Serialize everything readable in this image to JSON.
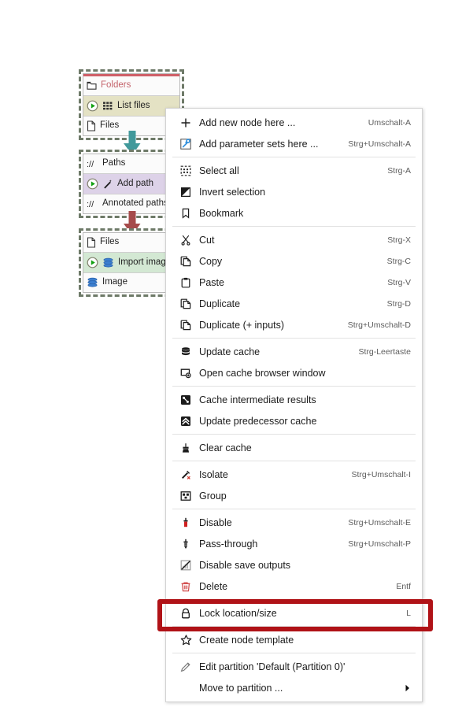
{
  "canvas": {
    "background": "#ffffff"
  },
  "workflow": {
    "nodes": [
      {
        "id": "list-files",
        "top_accent_color": "#cf5f68",
        "body_color": "#e4e2c4",
        "input_port": {
          "label": "Folders",
          "icon": "folder-icon",
          "label_color": "#c4636b"
        },
        "body": {
          "label": "List files",
          "icon": "table-grid-icon",
          "run_icon": "play-circle-icon"
        },
        "output_port": {
          "label": "Files",
          "icon": "file-icon",
          "label_color": "#333333"
        }
      },
      {
        "id": "add-path",
        "top_accent_color": "",
        "body_color": "#ddd2e8",
        "input_port": {
          "label": "Paths",
          "icon": "path-uri-icon",
          "label_color": "#333333"
        },
        "body": {
          "label": "Add path",
          "icon": "wand-icon",
          "run_icon": "play-circle-icon"
        },
        "output_port": {
          "label": "Annotated paths",
          "icon": "path-uri-icon",
          "label_color": "#333333"
        }
      },
      {
        "id": "import-image",
        "top_accent_color": "",
        "body_color": "#d3e8d3",
        "input_port": {
          "label": "Files",
          "icon": "file-icon",
          "label_color": "#333333"
        },
        "body": {
          "label": "Import image",
          "icon": "stack-layers-icon",
          "run_icon": "play-circle-icon"
        },
        "output_port": {
          "label": "Image",
          "icon": "stack-layers-icon",
          "label_color": "#333333"
        }
      }
    ],
    "connectors": [
      {
        "id": "conn-1",
        "icon": "down-arrow-icon",
        "color": "#3f9e9e"
      },
      {
        "id": "conn-2",
        "icon": "down-arrow-icon",
        "color": "#a54040"
      }
    ]
  },
  "context_menu": {
    "groups": [
      {
        "items": [
          {
            "icon": "plus-icon",
            "label": "Add new node here ...",
            "accel": "Umschalt-A"
          },
          {
            "icon": "wrench-icon",
            "label": "Add parameter sets here ...",
            "accel": "Strg+Umschalt-A"
          }
        ]
      },
      {
        "items": [
          {
            "icon": "select-all-icon",
            "label": "Select all",
            "accel": "Strg-A"
          },
          {
            "icon": "invert-selection-icon",
            "label": "Invert selection",
            "accel": ""
          },
          {
            "icon": "bookmark-icon",
            "label": "Bookmark",
            "accel": ""
          }
        ]
      },
      {
        "items": [
          {
            "icon": "scissors-icon",
            "label": "Cut",
            "accel": "Strg-X"
          },
          {
            "icon": "copy-icon",
            "label": "Copy",
            "accel": "Strg-C"
          },
          {
            "icon": "clipboard-icon",
            "label": "Paste",
            "accel": "Strg-V"
          },
          {
            "icon": "copy-icon",
            "label": "Duplicate",
            "accel": "Strg-D"
          },
          {
            "icon": "copy-icon",
            "label": "Duplicate (+ inputs)",
            "accel": "Strg+Umschalt-D"
          }
        ]
      },
      {
        "items": [
          {
            "icon": "database-icon",
            "label": "Update cache",
            "accel": "Strg-Leertaste"
          },
          {
            "icon": "window-plus-icon",
            "label": "Open cache browser window",
            "accel": ""
          }
        ]
      },
      {
        "items": [
          {
            "icon": "cache-intermediate-icon",
            "label": "Cache intermediate results",
            "accel": ""
          },
          {
            "icon": "chevrons-up-icon",
            "label": "Update predecessor cache",
            "accel": ""
          }
        ]
      },
      {
        "items": [
          {
            "icon": "broom-icon",
            "label": "Clear cache",
            "accel": ""
          }
        ]
      },
      {
        "items": [
          {
            "icon": "isolate-icon",
            "label": "Isolate",
            "accel": "Strg+Umschalt-I"
          },
          {
            "icon": "group-icon",
            "label": "Group",
            "accel": ""
          }
        ]
      },
      {
        "items": [
          {
            "icon": "disable-icon",
            "label": "Disable",
            "accel": "Strg+Umschalt-E"
          },
          {
            "icon": "pass-through-icon",
            "label": "Pass-through",
            "accel": "Strg+Umschalt-P"
          },
          {
            "icon": "disable-save-output-icon",
            "label": "Disable save outputs",
            "accel": ""
          },
          {
            "icon": "trash-icon",
            "label": "Delete",
            "accel": "Entf"
          }
        ]
      },
      {
        "items": [
          {
            "icon": "lock-icon",
            "label": "Lock location/size",
            "accel": "L"
          }
        ]
      },
      {
        "items": [
          {
            "icon": "star-icon",
            "label": "Create node template",
            "accel": "",
            "highlighted": true
          }
        ]
      },
      {
        "items": [
          {
            "icon": "pencil-icon",
            "label": "Edit partition 'Default (Partition 0)'",
            "accel": ""
          },
          {
            "icon": "none",
            "label": "Move to partition ...",
            "accel": "",
            "submenu": true
          }
        ]
      }
    ]
  },
  "annotation": {
    "highlight_color": "#b01217",
    "target_label": "Create node template"
  }
}
